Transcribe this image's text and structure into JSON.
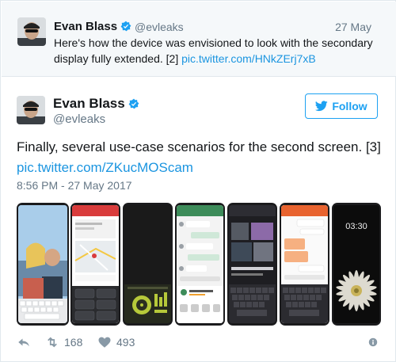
{
  "colors": {
    "brand_blue": "#1da1f2",
    "link_blue": "#1b95e0",
    "muted": "#657786",
    "text": "#14171a"
  },
  "parent_tweet": {
    "author_name": "Evan Blass",
    "handle": "@evleaks",
    "date": "27 May",
    "text": "Here's how the device was envisioned to look with the secondary display fully extended. [2] ",
    "link": "pic.twitter.com/HNkZErj7xB"
  },
  "tweet": {
    "author_name": "Evan Blass",
    "handle": "@evleaks",
    "follow_label": "Follow",
    "text": "Finally, several use-case scenarios for the second screen. [3]",
    "link": "pic.twitter.com/ZKucMOScam",
    "timestamp": "8:56 PM - 27 May 2017",
    "media": {
      "phones": [
        {
          "name": "phone-photo-keyboard"
        },
        {
          "name": "phone-maps-controls"
        },
        {
          "name": "phone-music-controller"
        },
        {
          "name": "phone-messaging"
        },
        {
          "name": "phone-music-player-keyboard"
        },
        {
          "name": "phone-chat-keyboard"
        },
        {
          "name": "phone-clock-flower"
        }
      ],
      "clock_time": "03:30"
    },
    "actions": {
      "reply_icon": "reply-icon",
      "retweet_icon": "retweet-icon",
      "retweet_count": "168",
      "like_icon": "heart-icon",
      "like_count": "493",
      "info_icon": "info-icon"
    }
  }
}
